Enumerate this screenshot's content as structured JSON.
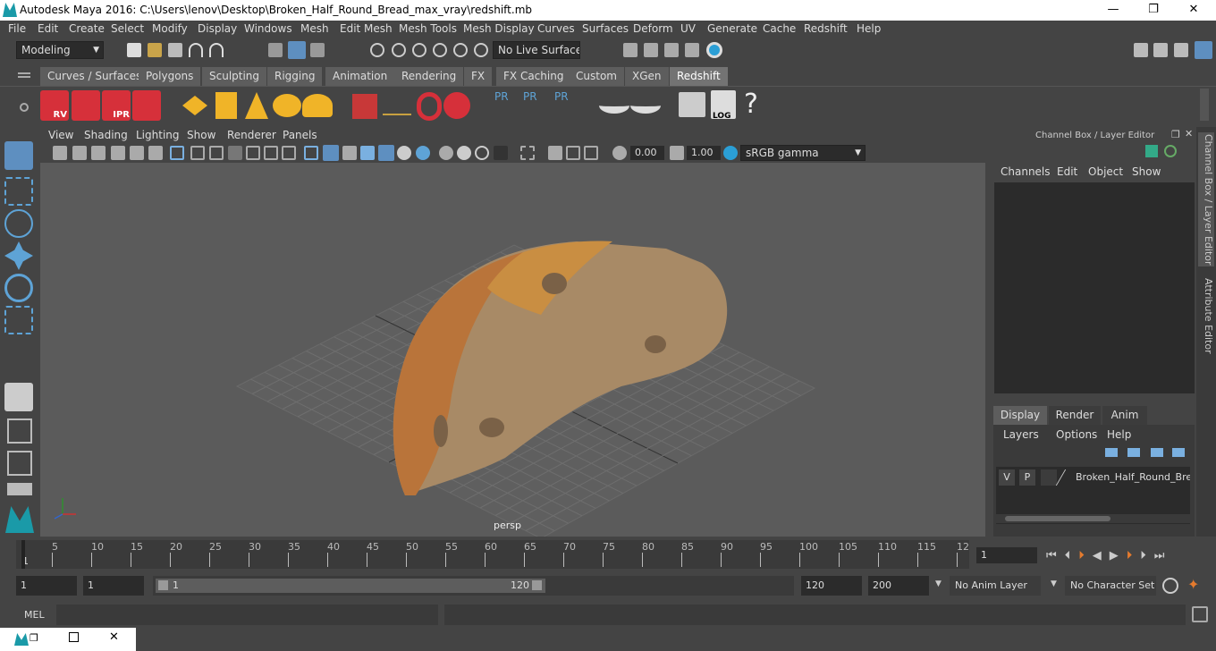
{
  "window": {
    "title": "Autodesk Maya 2016: C:\\Users\\lenov\\Desktop\\Broken_Half_Round_Bread_max_vray\\redshift.mb",
    "minimize": "—",
    "maximize": "❐",
    "close": "✕"
  },
  "menubar": [
    "File",
    "Edit",
    "Create",
    "Select",
    "Modify",
    "Display",
    "Windows",
    "Mesh",
    "Edit Mesh",
    "Mesh Tools",
    "Mesh Display",
    "Curves",
    "Surfaces",
    "Deform",
    "UV",
    "Generate",
    "Cache",
    "Redshift",
    "Help"
  ],
  "statusline": {
    "mode": "Modeling",
    "live_surface": "No Live Surface"
  },
  "shelf_tabs": [
    "Curves / Surfaces",
    "Polygons",
    "Sculpting",
    "Rigging",
    "Animation",
    "Rendering",
    "FX",
    "FX Caching",
    "Custom",
    "XGen",
    "Redshift"
  ],
  "active_shelf_tab": "Redshift",
  "shelf_labels": {
    "rv": "RV",
    "ipr": "IPR",
    "pr": "PR",
    "log": "LOG",
    "help": "?"
  },
  "viewport_menu": [
    "View",
    "Shading",
    "Lighting",
    "Show",
    "Renderer",
    "Panels"
  ],
  "viewport_toolbar": {
    "exposure": "0.00",
    "gamma": "1.00",
    "color_space": "sRGB gamma"
  },
  "camera_label": "persp",
  "channel_box": {
    "title": "Channel Box / Layer Editor",
    "menu": [
      "Channels",
      "Edit",
      "Object",
      "Show"
    ],
    "layer_tabs": [
      "Display",
      "Render",
      "Anim"
    ],
    "active_layer_tab": "Display",
    "layer_menu": [
      "Layers",
      "Options",
      "Help"
    ],
    "layer": {
      "v": "V",
      "p": "P",
      "name": "Broken_Half_Round_Brea"
    }
  },
  "side_tabs": [
    "Channel Box / Layer Editor",
    "Attribute Editor"
  ],
  "timeline": {
    "ticks": [
      "5",
      "10",
      "15",
      "20",
      "25",
      "30",
      "35",
      "40",
      "45",
      "50",
      "55",
      "60",
      "65",
      "70",
      "75",
      "80",
      "85",
      "90",
      "95",
      "100",
      "105",
      "110",
      "115",
      "12"
    ],
    "start_mark": "1",
    "current_frame": "1"
  },
  "range": {
    "start": "1",
    "playback_start": "1",
    "slider_start": "1",
    "slider_end": "120",
    "playback_end": "120",
    "end": "200",
    "anim_layer": "No Anim Layer",
    "character_set": "No Character Set"
  },
  "cmdline": {
    "label": "MEL"
  },
  "colors": {
    "accent": "#5ea3d6",
    "shelf_red": "#d6303a",
    "shelf_yellow": "#f0b428",
    "active_tab": "#737373",
    "bread_crust": "#b9743a",
    "bread_crumb": "#a88a66"
  }
}
